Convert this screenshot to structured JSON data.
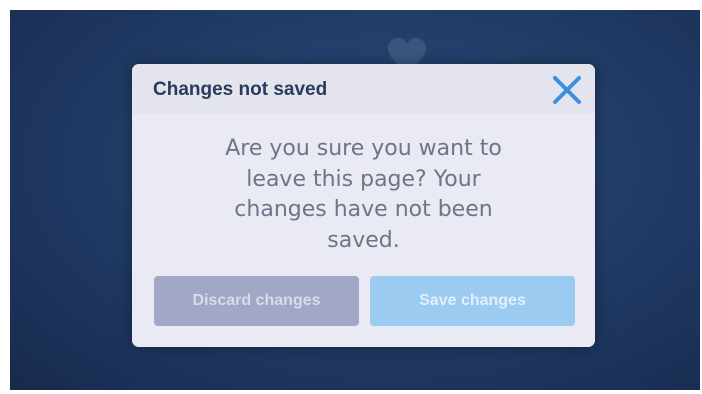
{
  "dialog": {
    "title": "Changes not saved",
    "close_icon": "close-icon",
    "message": "Are you sure you want to leave this page? Your changes have not been saved.",
    "discard_label": "Discard changes",
    "save_label": "Save changes"
  },
  "colors": {
    "accent": "#3a8fe0",
    "title_text": "#2a3b5c",
    "discard_button": "#a3a7c6",
    "save_button": "#9ccbf1",
    "backdrop": "#223d68"
  },
  "background": {
    "icon": "heart-icon"
  }
}
